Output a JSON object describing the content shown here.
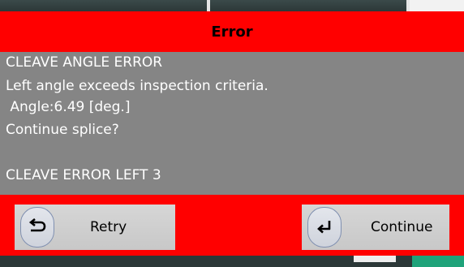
{
  "dialog": {
    "title": "Error",
    "message_lines": [
      "CLEAVE ANGLE ERROR",
      "Left angle exceeds inspection criteria.",
      " Angle:6.49 [deg.]",
      "Continue splice?",
      "",
      "CLEAVE ERROR LEFT 3"
    ],
    "buttons": {
      "retry": {
        "label": "Retry",
        "icon": "undo-arrow-icon"
      },
      "continue": {
        "label": "Continue",
        "icon": "enter-return-icon"
      }
    }
  },
  "colors": {
    "dialog_frame": "#ff0000",
    "dialog_body": "#858585",
    "message_text": "#ffffff",
    "button_face": "#cccccc"
  }
}
